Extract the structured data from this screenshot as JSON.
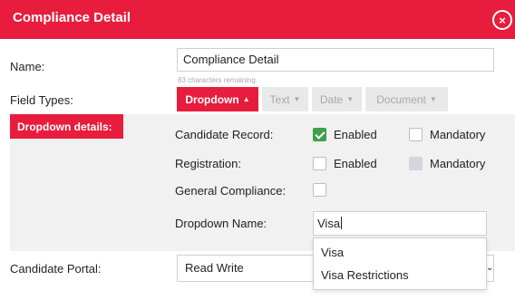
{
  "dialog": {
    "title": "Compliance Detail",
    "close_icon": "close-icon",
    "close_glyph": "×",
    "accent_color": "#e81c3c"
  },
  "name_field": {
    "label": "Name:",
    "value": "Compliance Detail",
    "hint": "83 characters remaining."
  },
  "field_types": {
    "label": "Field Types:",
    "buttons": [
      {
        "label": "Dropdown",
        "caret": "▲",
        "active": true
      },
      {
        "label": "Text",
        "caret": "▼",
        "active": false
      },
      {
        "label": "Date",
        "caret": "▼",
        "active": false
      },
      {
        "label": "Document",
        "caret": "▼",
        "active": false
      }
    ]
  },
  "dropdown_details": {
    "tag": "Dropdown details:",
    "rows": [
      {
        "label": "Candidate Record:",
        "enabled_label": "Enabled",
        "enabled_checked": true,
        "mandatory_label": "Mandatory",
        "mandatory_checked": false
      },
      {
        "label": "Registration:",
        "enabled_label": "Enabled",
        "enabled_checked": false,
        "mandatory_label": "Mandatory",
        "mandatory_disabled": true
      },
      {
        "label": "General Compliance:",
        "checked": false
      }
    ],
    "dropdown_name": {
      "label": "Dropdown Name:",
      "value": "Visa",
      "suggestions": [
        "Visa",
        "Visa Restrictions"
      ]
    }
  },
  "candidate_portal": {
    "label": "Candidate Portal:",
    "selected": "Read Write",
    "chevron_icon": "chevron-down-icon",
    "chevron_glyph": "⌄"
  },
  "colors": {
    "enabled_check": "#3fa04a",
    "panel_bg": "#f1f1f1"
  }
}
